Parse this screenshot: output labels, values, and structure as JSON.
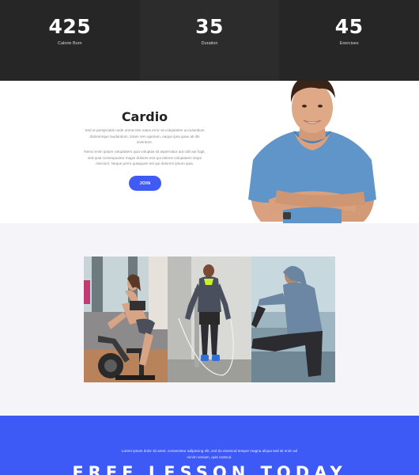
{
  "stats": [
    {
      "value": "425",
      "label": "Calorie Burn"
    },
    {
      "value": "35",
      "label": "Duration"
    },
    {
      "value": "45",
      "label": "Exercises"
    }
  ],
  "cardio": {
    "title": "Cardio",
    "paragraph1": "Sed ut perspiciatis unde omnis iste natus error sit voluptatem accusantium doloremque laudantium, totam rem aperiam, eaque ipsa quae ab illo inventore.",
    "paragraph2": "Nemo enim ipsam voluptatem quia voluptas sit aspernatur aut odit aut fugit, sed quia consequuntur magni dolores eos qui ratione voluptatem sequi nesciunt. Neque porro quisquam est qui dolorem ipsum quia.",
    "join_label": "JOIN"
  },
  "lesson": {
    "text": "Lorem ipsum dolor sit amet, consectetur adipiscing elit, sed do eiusmod tempor magna aliqua sed sit enim ad minim veniam, quis nostrud.",
    "title": "FREE LESSON TODAY"
  },
  "colors": {
    "accent": "#3e5af6",
    "stats_background": "#262626",
    "gallery_background": "#f5f4f8"
  }
}
